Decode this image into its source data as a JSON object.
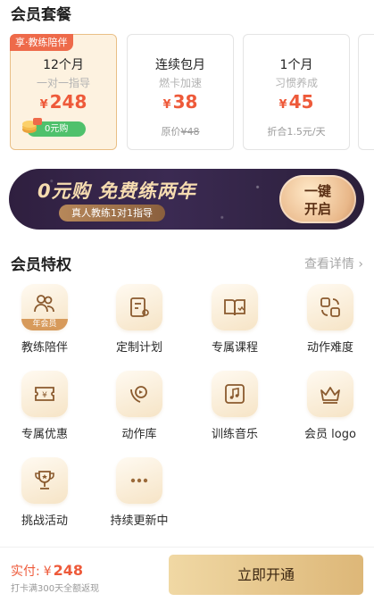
{
  "plans": {
    "title": "会员套餐",
    "items": [
      {
        "tag": "享·教练陪伴",
        "name": "12个月",
        "sub": "一对一指导",
        "currency": "¥",
        "price": "248",
        "badge": "0元购"
      },
      {
        "name": "连续包月",
        "sub": "燃卡加速",
        "currency": "¥",
        "price": "38",
        "foot_label": "原价",
        "foot_value": "¥48"
      },
      {
        "name": "1个月",
        "sub": "习惯养成",
        "currency": "¥",
        "price": "45",
        "foot": "折合1.5元/天"
      }
    ]
  },
  "banner": {
    "title": "0元购  免费练两年",
    "subtitle": "真人教练1对1指导",
    "button_line1": "一键",
    "button_line2": "开启"
  },
  "privileges": {
    "title": "会员特权",
    "see_more": "查看详情 ›",
    "annual_tag": "年会员",
    "items": [
      {
        "label": "教练陪伴",
        "icon": "coach-icon"
      },
      {
        "label": "定制计划",
        "icon": "plan-icon"
      },
      {
        "label": "专属课程",
        "icon": "course-icon"
      },
      {
        "label": "动作难度",
        "icon": "difficulty-icon"
      },
      {
        "label": "专属优惠",
        "icon": "coupon-icon"
      },
      {
        "label": "动作库",
        "icon": "library-icon"
      },
      {
        "label": "训练音乐",
        "icon": "music-icon"
      },
      {
        "label": "会员 logo",
        "icon": "crown-icon"
      },
      {
        "label": "挑战活动",
        "icon": "trophy-icon"
      },
      {
        "label": "持续更新中",
        "icon": "more-icon"
      }
    ]
  },
  "checkout": {
    "pay_label": "实付:",
    "currency": "¥",
    "amount": "248",
    "note": "打卡满300天全额返现",
    "button": "立即开通"
  },
  "colors": {
    "accent": "#ee5a3a",
    "gold": "#ddb778",
    "badge_green": "#4fc16c",
    "banner_bg": "#2f1f3f"
  }
}
